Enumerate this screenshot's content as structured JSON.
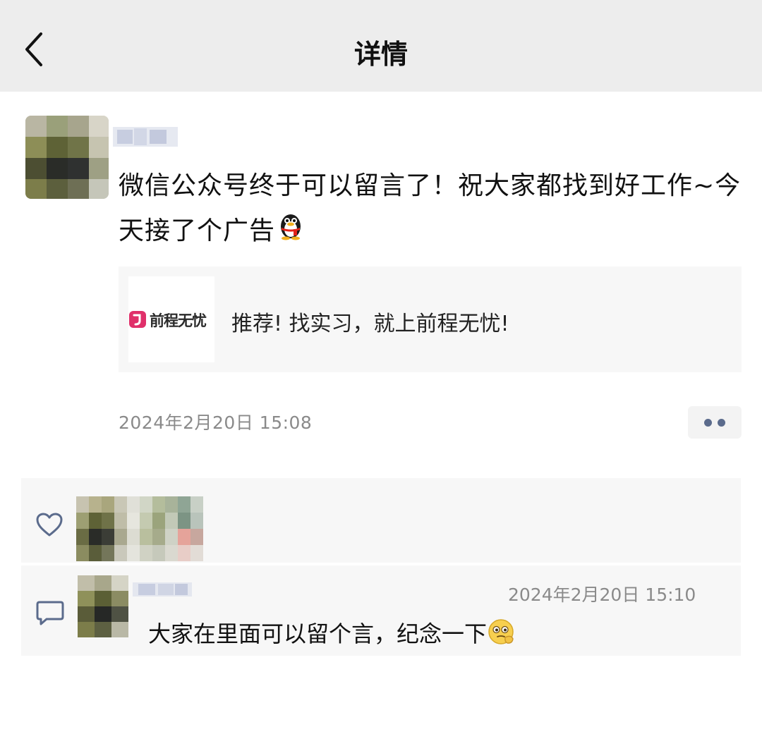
{
  "nav": {
    "title": "详情",
    "back_icon": "chevron-left-icon"
  },
  "post": {
    "text": "微信公众号终于可以留言了！祝大家都找到好工作~今天接了个广告",
    "emoji": "qq-penguin-emoji",
    "card": {
      "logo_text": "前程无忧",
      "text": "推荐! 找实习，就上前程无忧!"
    },
    "time": "2024年2月20日  15:08",
    "more_icon": "more-dots-icon"
  },
  "likes": {
    "icon": "heart-icon"
  },
  "comments": [
    {
      "time": "2024年2月20日  15:10",
      "text": "大家在里面可以留个言，纪念一下",
      "emoji": "thinking-face-emoji"
    }
  ],
  "colors": {
    "nav_bg": "#ededed",
    "panel_bg": "#f7f7f7",
    "meta_text": "#8a8a8a",
    "link_blue": "#5b6b8c"
  }
}
